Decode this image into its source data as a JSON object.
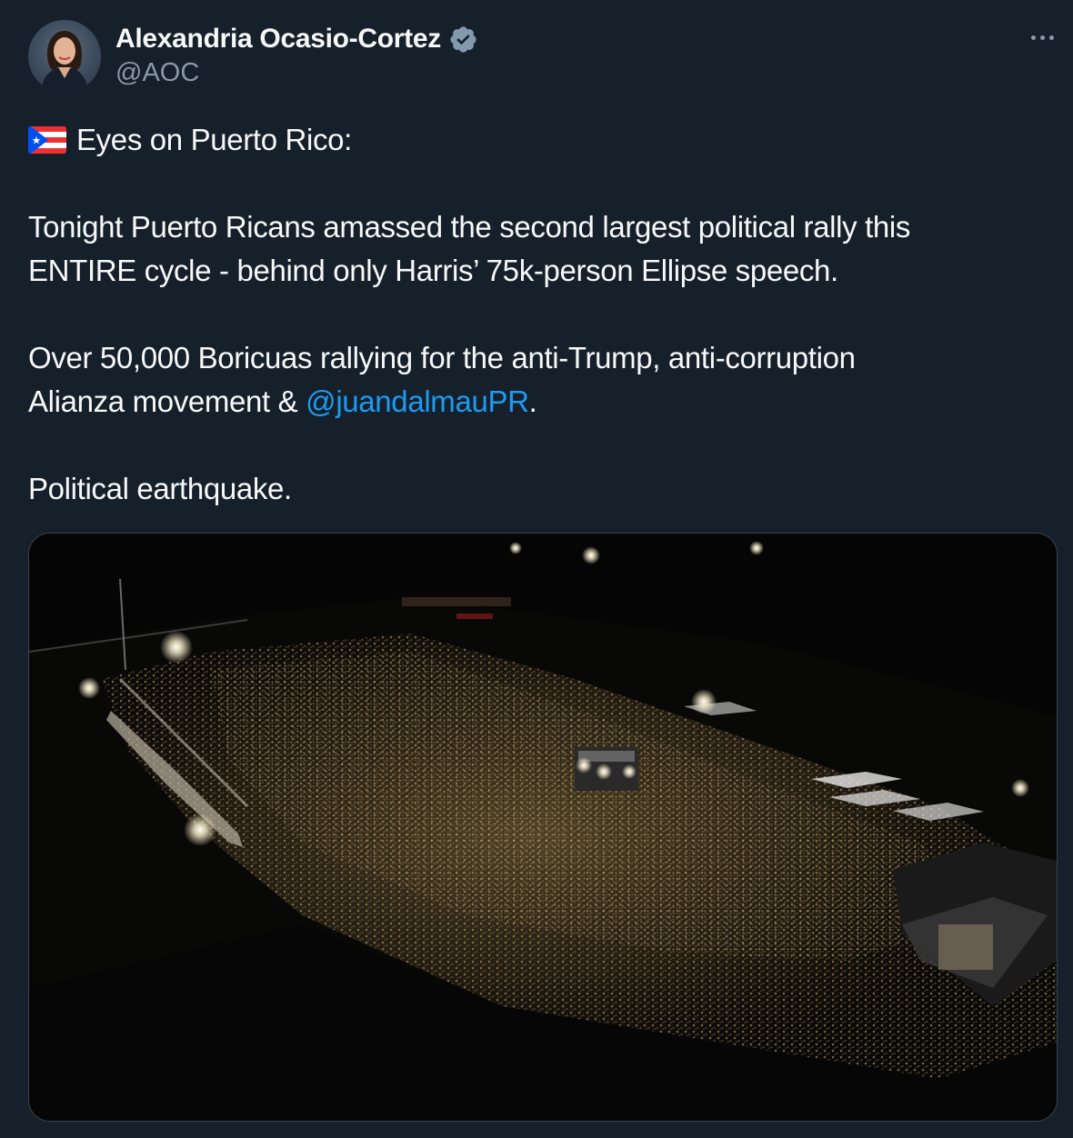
{
  "author": {
    "display_name": "Alexandria Ocasio-Cortez",
    "handle": "@AOC",
    "verified": true,
    "avatar_icon": "profile-photo"
  },
  "menu": {
    "icon": "more-options-icon"
  },
  "tweet": {
    "flag_icon": "puerto-rico-flag",
    "line1": "Eyes on Puerto Rico:",
    "para2_line1": "Tonight Puerto Ricans amassed the second largest political rally this",
    "para2_line2": "ENTIRE cycle - behind only Harris’ 75k-person Ellipse speech.",
    "para3_line1": "Over 50,000 Boricuas rallying for the anti-Trump, anti-corruption",
    "para3_line2_prefix": "Alianza movement & ",
    "mention": "@juandalmauPR",
    "para3_line2_suffix": ".",
    "para4": "Political earthquake."
  },
  "media": {
    "type": "photo"
  },
  "colors": {
    "background": "#15202b",
    "text": "#f7f9f9",
    "secondary": "#8b98a5",
    "link": "#1d9bf0",
    "verified": "#829aab"
  }
}
